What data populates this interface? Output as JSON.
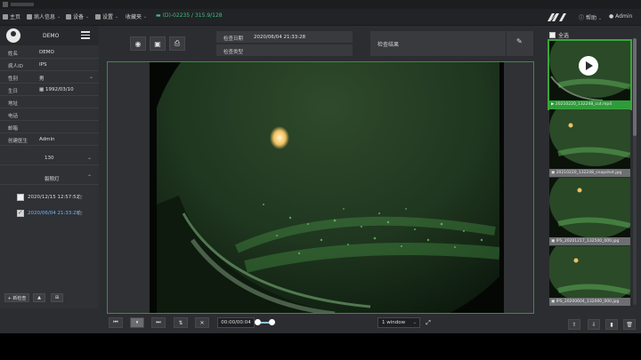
{
  "nav": {
    "home": "主页",
    "patient_info": "病人信息",
    "device": "设备",
    "settings": "设置",
    "favorites": "收藏夹",
    "ip": "(D)-02235 / 315.9/128",
    "help": "帮助",
    "user": "Admin"
  },
  "patient": {
    "name_display": "DEMO",
    "fields": [
      {
        "key": "姓名",
        "value": "DEMO"
      },
      {
        "key": "病人ID",
        "value": "IPS"
      },
      {
        "key": "性别",
        "value": "男"
      },
      {
        "key": "生日",
        "value": "1992/03/10"
      },
      {
        "key": "地址",
        "value": ""
      },
      {
        "key": "电话",
        "value": ""
      },
      {
        "key": "邮箱",
        "value": ""
      },
      {
        "key": "创建医生",
        "value": "Admin"
      }
    ]
  },
  "records": {
    "group1_title": "130",
    "group2_title": "裂隙灯",
    "items": [
      {
        "date": "2020/12/15 12:57:52",
        "checked": false
      },
      {
        "date": "2020/06/04 21:33:28",
        "checked": true
      }
    ]
  },
  "left_buttons": [
    "+ 新检查",
    "▲",
    "⊞"
  ],
  "exam": {
    "date_label": "检查日期",
    "date_value": "2020/06/04 21:33:28",
    "type_label": "检查类型",
    "type_value": "",
    "result_label": "检查结果"
  },
  "controls": {
    "time": "00:00/00:04",
    "window": "1 window",
    "speed_fraction": 0.85
  },
  "gallery": {
    "select_all": "全选",
    "items": [
      {
        "caption": "20210220_132248_cut.mp4",
        "selected": true,
        "video": true
      },
      {
        "caption": "20210220_132248_snapshot.jpg",
        "selected": false,
        "video": false
      },
      {
        "caption": "IPS_20201217_132500_000.jpg",
        "selected": false,
        "video": false
      },
      {
        "caption": "IPS_20200604_132000_000.jpg",
        "selected": false,
        "video": false
      }
    ]
  }
}
